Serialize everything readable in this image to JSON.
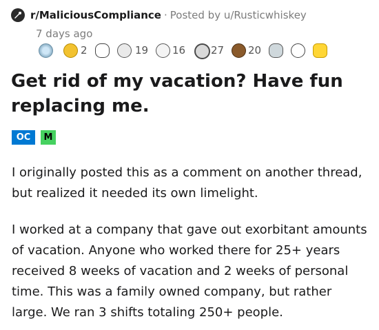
{
  "header": {
    "subreddit": "r/MaliciousCompliance",
    "separator": "·",
    "posted_by_label": "Posted by",
    "author": "u/Rusticwhiskey",
    "timestamp": "7 days ago"
  },
  "awards": [
    {
      "name": "silver-face-award",
      "count": ""
    },
    {
      "name": "gold-star-award",
      "count": "2"
    },
    {
      "name": "wholesome-hands-award",
      "count": ""
    },
    {
      "name": "hugz-award",
      "count": "19"
    },
    {
      "name": "helpful-award",
      "count": "16"
    },
    {
      "name": "silver-coin-award",
      "count": "27"
    },
    {
      "name": "bear-award",
      "count": "20"
    },
    {
      "name": "mind-blown-award",
      "count": ""
    },
    {
      "name": "snoo-award",
      "count": ""
    },
    {
      "name": "gold-upvote-award",
      "count": ""
    }
  ],
  "post": {
    "title": "Get rid of my vacation? Have fun replacing me.",
    "flairs": {
      "oc": "OC",
      "m": "M"
    },
    "paragraphs": [
      "I originally posted this as a comment on another thread, but realized it needed its own limelight.",
      "I worked at a company that gave out exorbitant amounts of vacation. Anyone who worked there for 25+ years received 8 weeks of vacation and 2 weeks of personal time. This was a family owned company, but rather large. We ran 3 shifts totaling 250+ people."
    ]
  },
  "colors": {
    "flair_oc": "#0079d3",
    "flair_m": "#46d160",
    "meta_text": "#7c7c7c"
  }
}
